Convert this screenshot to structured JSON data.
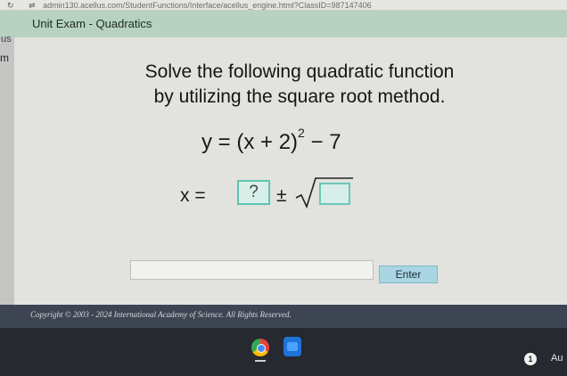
{
  "browser": {
    "url": "admin130.acellus.com/StudentFunctions/Interface/acellus_engine.html?ClassID=987147406"
  },
  "header": {
    "title": "Unit Exam - Quadratics"
  },
  "sidebar": {
    "fragment_top": "us",
    "fragment_bottom": "m"
  },
  "question": {
    "prompt_line1": "Solve the following quadratic function",
    "prompt_line2": "by utilizing the square root method.",
    "equation": {
      "lhs": "y = (x + 2)",
      "exponent": "2",
      "rhs": " − 7"
    },
    "answer_template": {
      "lhs": "x =",
      "placeholder": "?",
      "plus_minus": "±"
    }
  },
  "answer": {
    "input_value": "",
    "enter_label": "Enter"
  },
  "footer": {
    "copyright": "Copyright © 2003 - 2024 International Academy of Science.  All Rights Reserved."
  },
  "taskbar": {
    "notification_count": "1",
    "user_fragment": "Au",
    "icons": [
      "chrome-icon",
      "files-icon"
    ]
  },
  "colors": {
    "header_bg": "#b7d2c0",
    "input_box_border": "#5ec4b0",
    "enter_button": "#a9d6e2",
    "footer_bg": "#3d4552"
  }
}
